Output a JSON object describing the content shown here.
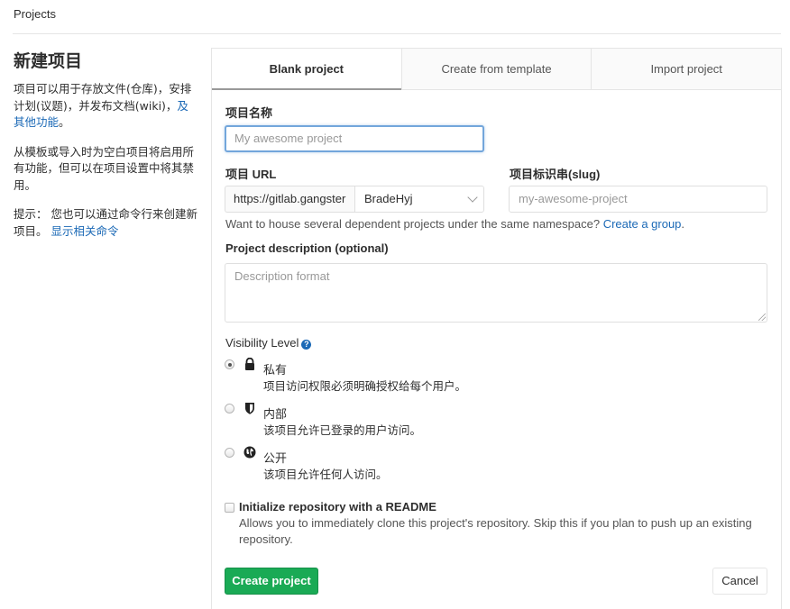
{
  "breadcrumb": {
    "label": "Projects"
  },
  "sidebar": {
    "title": "新建项目",
    "para1_text": "项目可以用于存放文件(仓库)，安排计划(议题)，并发布文档(wiki)，",
    "para1_link": "及其他功能",
    "para1_end": "。",
    "para2": "从模板或导入时为空白项目将启用所有功能，但可以在项目设置中将其禁用。",
    "para3_text": "提示： 您也可以通过命令行来创建新项目。",
    "para3_link": "显示相关命令"
  },
  "tabs": [
    {
      "label": "Blank project",
      "active": true
    },
    {
      "label": "Create from template",
      "active": false
    },
    {
      "label": "Import project",
      "active": false
    }
  ],
  "form": {
    "name_label": "项目名称",
    "name_placeholder": "My awesome project",
    "url_label": "项目 URL",
    "url_prefix": "https://gitlab.gangster",
    "namespace": "BradeHyj",
    "slug_label": "项目标识串(slug)",
    "slug_placeholder": "my-awesome-project",
    "group_help_text": "Want to house several dependent projects under the same namespace?",
    "group_help_link": "Create a group",
    "group_help_end": ".",
    "description_label": "Project description (optional)",
    "description_placeholder": "Description format",
    "visibility_label": "Visibility Level",
    "visibility_options": [
      {
        "title": "私有",
        "desc": "项目访问权限必须明确授权给每个用户。",
        "icon": "lock-icon",
        "selected": true
      },
      {
        "title": "内部",
        "desc": "该项目允许已登录的用户访问。",
        "icon": "shield-icon",
        "selected": false
      },
      {
        "title": "公开",
        "desc": "该项目允许任何人访问。",
        "icon": "globe-icon",
        "selected": false
      }
    ],
    "readme_label": "Initialize repository with a README",
    "readme_desc": "Allows you to immediately clone this project's repository. Skip this if you plan to push up an existing repository.",
    "readme_checked": false,
    "create_button": "Create project",
    "cancel_button": "Cancel"
  },
  "colors": {
    "primary_green": "#1aaa55",
    "link_blue": "#1b69b6",
    "focus_blue": "#73a6db"
  }
}
